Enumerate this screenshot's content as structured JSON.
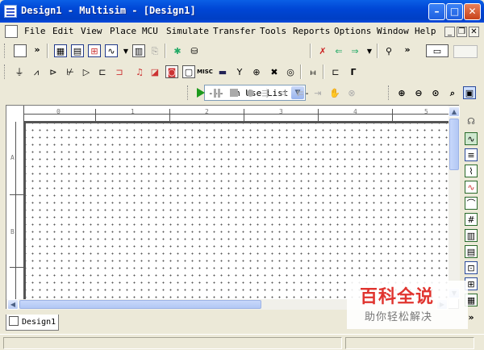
{
  "window": {
    "title": "Design1 - Multisim - [Design1]",
    "minimize_glyph": "–",
    "maximize_glyph": "□",
    "close_glyph": "✕"
  },
  "menubar": {
    "items": [
      "File",
      "Edit",
      "View",
      "Place",
      "MCU",
      "Simulate",
      "Transfer",
      "Tools",
      "Reports",
      "Options",
      "Window",
      "Help"
    ],
    "mdi_minimize": "_",
    "mdi_restore": "❐",
    "mdi_close": "✕"
  },
  "toolbar": {
    "in_use_list": "--- In Use List ---",
    "dropdown_glyph": "▼",
    "chevron": "»"
  },
  "simulation": {
    "run_icon": "run-icon",
    "pause_icon": "pause-icon",
    "stop_icon": "stop-icon"
  },
  "canvas": {
    "ruler_top_labels": [
      "0",
      "1",
      "2",
      "3",
      "4",
      "5"
    ],
    "ruler_left_labels": [
      "A",
      "B"
    ],
    "scroll_up": "▲",
    "scroll_down": "▼",
    "scroll_left": "◀",
    "scroll_right": "▶",
    "colors": {
      "canvas": "#ffffff",
      "grid_dot": "#555555",
      "frame": "#ece9d8",
      "titlebar": "#0046d5"
    }
  },
  "tabs": [
    {
      "label": "Design1"
    }
  ],
  "watermark": {
    "title": "百科全说",
    "subtitle": "助你轻松解决"
  }
}
